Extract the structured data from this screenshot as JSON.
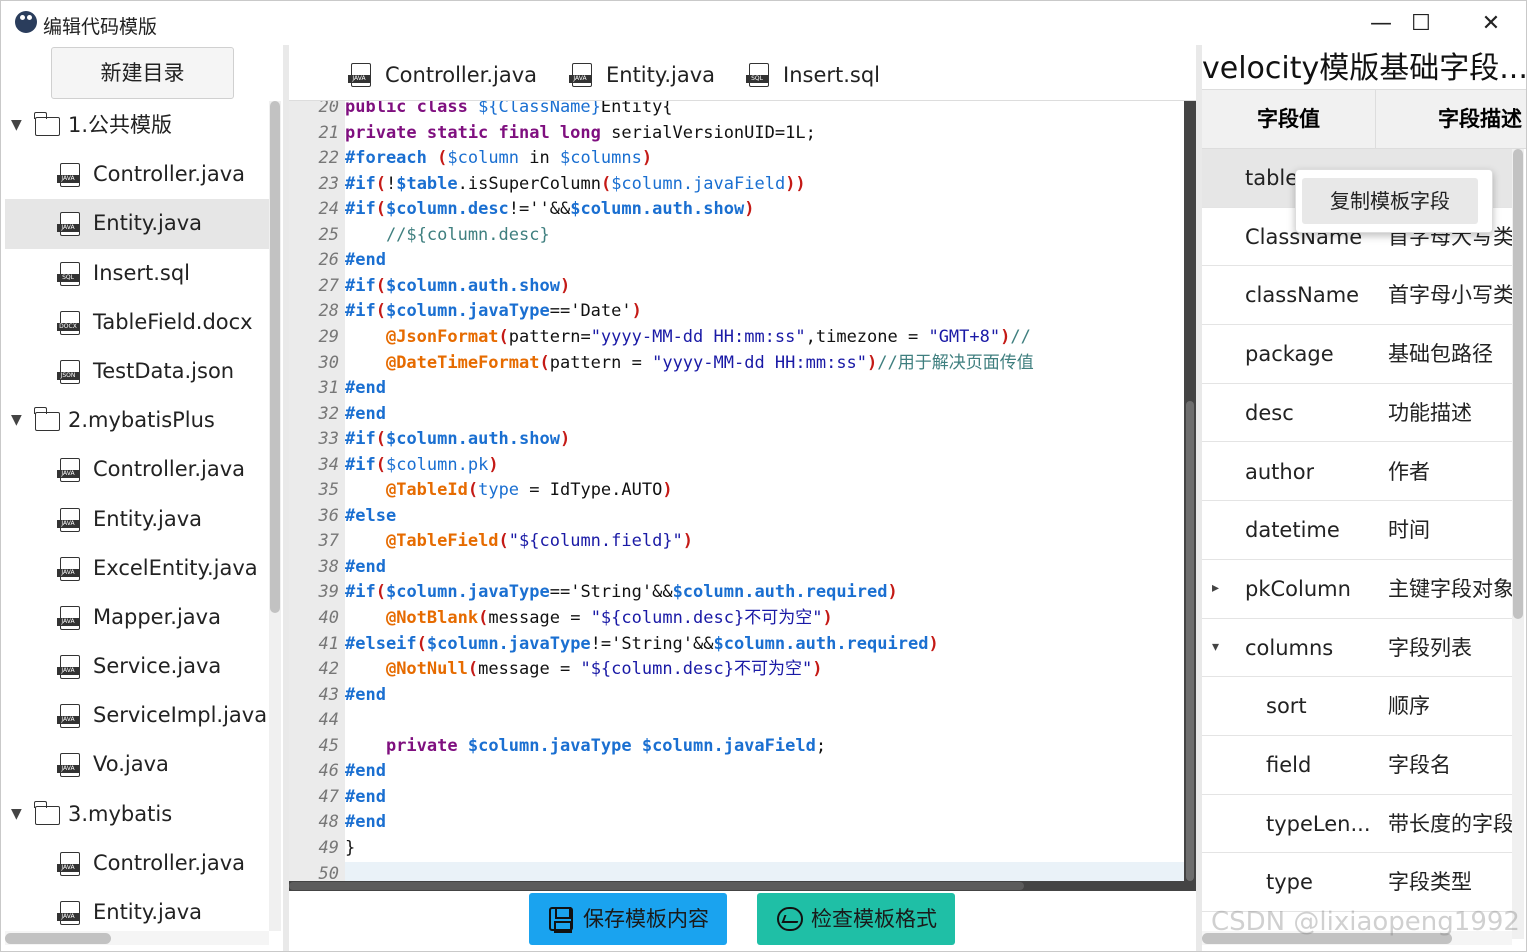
{
  "window": {
    "title": "编辑代码模版",
    "minimize": "—",
    "maximize": "☐",
    "close": "✕"
  },
  "left": {
    "new_dir_label": "新建目录",
    "tree": [
      {
        "kind": "folder",
        "label": "1.公共模版",
        "expanded": true
      },
      {
        "kind": "file",
        "label": "Controller.java",
        "ext": "JAVA"
      },
      {
        "kind": "file",
        "label": "Entity.java",
        "ext": "JAVA",
        "selected": true
      },
      {
        "kind": "file",
        "label": "Insert.sql",
        "ext": "SQL"
      },
      {
        "kind": "file",
        "label": "TableField.docx",
        "ext": "DOCX"
      },
      {
        "kind": "file",
        "label": "TestData.json",
        "ext": "JSON"
      },
      {
        "kind": "folder",
        "label": "2.mybatisPlus",
        "expanded": true
      },
      {
        "kind": "file",
        "label": "Controller.java",
        "ext": "JAVA"
      },
      {
        "kind": "file",
        "label": "Entity.java",
        "ext": "JAVA"
      },
      {
        "kind": "file",
        "label": "ExcelEntity.java",
        "ext": "JAVA"
      },
      {
        "kind": "file",
        "label": "Mapper.java",
        "ext": "JAVA"
      },
      {
        "kind": "file",
        "label": "Service.java",
        "ext": "JAVA"
      },
      {
        "kind": "file",
        "label": "ServiceImpl.java",
        "ext": "JAVA"
      },
      {
        "kind": "file",
        "label": "Vo.java",
        "ext": "JAVA"
      },
      {
        "kind": "folder",
        "label": "3.mybatis",
        "expanded": true
      },
      {
        "kind": "file",
        "label": "Controller.java",
        "ext": "JAVA"
      },
      {
        "kind": "file",
        "label": "Entity.java",
        "ext": "JAVA"
      }
    ]
  },
  "editor": {
    "tabs": [
      {
        "label": "Controller.java",
        "ext": "JAVA"
      },
      {
        "label": "Entity.java",
        "ext": "JAVA"
      },
      {
        "label": "Insert.sql",
        "ext": "SQL"
      }
    ],
    "colors": {
      "keyword": "#7f0f7f",
      "directive": "#1a6fd1",
      "variable": "#1a6fd1",
      "annotation": "#e66b00",
      "string": "#1a1aa6",
      "paren": "#c41a16",
      "comment": "#3f7f7f"
    },
    "lines": [
      {
        "n": "20",
        "tokens": [
          [
            "kw",
            "public class "
          ],
          [
            "var",
            "${ClassName}"
          ],
          [
            "",
            "Entity{"
          ]
        ]
      },
      {
        "n": "21",
        "tokens": [
          [
            "kw",
            "private static final long "
          ],
          [
            "",
            "serialVersionUID=1L;"
          ]
        ]
      },
      {
        "n": "22",
        "tokens": [
          [
            "dir",
            "#foreach "
          ],
          [
            "par",
            "("
          ],
          [
            "var",
            "$column"
          ],
          [
            "",
            " in "
          ],
          [
            "var",
            "$columns"
          ],
          [
            "par",
            ")"
          ]
        ]
      },
      {
        "n": "23",
        "tokens": [
          [
            "dir",
            "#if"
          ],
          [
            "par",
            "("
          ],
          [
            "",
            "!"
          ],
          [
            "var",
            "$table"
          ],
          [
            "",
            ".isSuperColumn"
          ],
          [
            "par",
            "("
          ],
          [
            "var",
            "$column.javaField"
          ],
          [
            "par",
            "))"
          ]
        ]
      },
      {
        "n": "24",
        "tokens": [
          [
            "dir",
            "#if"
          ],
          [
            "par",
            "("
          ],
          [
            "var",
            "$column.desc"
          ],
          [
            "",
            "!=''&&"
          ],
          [
            "var",
            "$column.auth.show"
          ],
          [
            "par",
            ")"
          ]
        ]
      },
      {
        "n": "25",
        "tokens": [
          [
            "com",
            "    //${column.desc}"
          ]
        ]
      },
      {
        "n": "26",
        "tokens": [
          [
            "dir",
            "#end"
          ]
        ]
      },
      {
        "n": "27",
        "tokens": [
          [
            "dir",
            "#if"
          ],
          [
            "par",
            "("
          ],
          [
            "var",
            "$column.auth.show"
          ],
          [
            "par",
            ")"
          ]
        ]
      },
      {
        "n": "28",
        "tokens": [
          [
            "dir",
            "#if"
          ],
          [
            "par",
            "("
          ],
          [
            "var",
            "$column.javaType"
          ],
          [
            "",
            "=='Date'"
          ],
          [
            "par",
            ")"
          ]
        ]
      },
      {
        "n": "29",
        "tokens": [
          [
            "",
            "    "
          ],
          [
            "ann",
            "@JsonFormat"
          ],
          [
            "par",
            "("
          ],
          [
            "",
            "pattern="
          ],
          [
            "str",
            "\"yyyy-MM-dd HH:mm:ss\""
          ],
          [
            "",
            ",timezone = "
          ],
          [
            "str",
            "\"GMT+8\""
          ],
          [
            "par",
            ")"
          ],
          [
            "com",
            "//"
          ]
        ]
      },
      {
        "n": "30",
        "tokens": [
          [
            "",
            "    "
          ],
          [
            "ann",
            "@DateTimeFormat"
          ],
          [
            "par",
            "("
          ],
          [
            "",
            "pattern = "
          ],
          [
            "str",
            "\"yyyy-MM-dd HH:mm:ss\""
          ],
          [
            "par",
            ")"
          ],
          [
            "com",
            "//用于解决页面传值"
          ]
        ]
      },
      {
        "n": "31",
        "tokens": [
          [
            "dir",
            "#end"
          ]
        ]
      },
      {
        "n": "32",
        "tokens": [
          [
            "dir",
            "#end"
          ]
        ]
      },
      {
        "n": "33",
        "tokens": [
          [
            "dir",
            "#if"
          ],
          [
            "par",
            "("
          ],
          [
            "var",
            "$column.auth.show"
          ],
          [
            "par",
            ")"
          ]
        ]
      },
      {
        "n": "34",
        "tokens": [
          [
            "dir",
            "#if"
          ],
          [
            "par",
            "("
          ],
          [
            "var",
            "$column.pk"
          ],
          [
            "par",
            ")"
          ]
        ]
      },
      {
        "n": "35",
        "tokens": [
          [
            "",
            "    "
          ],
          [
            "ann",
            "@TableId"
          ],
          [
            "par",
            "("
          ],
          [
            "var",
            "type"
          ],
          [
            "",
            " = IdType.AUTO"
          ],
          [
            "par",
            ")"
          ]
        ]
      },
      {
        "n": "36",
        "tokens": [
          [
            "dir",
            "#else"
          ]
        ]
      },
      {
        "n": "37",
        "tokens": [
          [
            "",
            "    "
          ],
          [
            "ann",
            "@TableField"
          ],
          [
            "par",
            "("
          ],
          [
            "str",
            "\"${column.field}\""
          ],
          [
            "par",
            ")"
          ]
        ]
      },
      {
        "n": "38",
        "tokens": [
          [
            "dir",
            "#end"
          ]
        ]
      },
      {
        "n": "39",
        "tokens": [
          [
            "dir",
            "#if"
          ],
          [
            "par",
            "("
          ],
          [
            "var",
            "$column.javaType"
          ],
          [
            "",
            "=='String'&&"
          ],
          [
            "var",
            "$column.auth.required"
          ],
          [
            "par",
            ")"
          ]
        ]
      },
      {
        "n": "40",
        "tokens": [
          [
            "",
            "    "
          ],
          [
            "ann",
            "@NotBlank"
          ],
          [
            "par",
            "("
          ],
          [
            "",
            "message = "
          ],
          [
            "str",
            "\"${column.desc}不可为空\""
          ],
          [
            "par",
            ")"
          ]
        ]
      },
      {
        "n": "41",
        "tokens": [
          [
            "dir",
            "#elseif"
          ],
          [
            "par",
            "("
          ],
          [
            "var",
            "$column.javaType"
          ],
          [
            "",
            "!='String'&&"
          ],
          [
            "var",
            "$column.auth.required"
          ],
          [
            "par",
            ")"
          ]
        ]
      },
      {
        "n": "42",
        "tokens": [
          [
            "",
            "    "
          ],
          [
            "ann",
            "@NotNull"
          ],
          [
            "par",
            "("
          ],
          [
            "",
            "message = "
          ],
          [
            "str",
            "\"${column.desc}不可为空\""
          ],
          [
            "par",
            ")"
          ]
        ]
      },
      {
        "n": "43",
        "tokens": [
          [
            "dir",
            "#end"
          ]
        ]
      },
      {
        "n": "44",
        "tokens": []
      },
      {
        "n": "45",
        "tokens": [
          [
            "",
            "    "
          ],
          [
            "kw",
            "private "
          ],
          [
            "var",
            "$column.javaType $column.javaField"
          ],
          [
            "",
            ";"
          ]
        ]
      },
      {
        "n": "46",
        "tokens": [
          [
            "dir",
            "#end"
          ]
        ]
      },
      {
        "n": "47",
        "tokens": [
          [
            "dir",
            "#end"
          ]
        ]
      },
      {
        "n": "48",
        "tokens": [
          [
            "dir",
            "#end"
          ]
        ]
      },
      {
        "n": "49",
        "tokens": [
          [
            "",
            "}"
          ]
        ]
      },
      {
        "n": "50",
        "tokens": [],
        "current": true
      }
    ]
  },
  "buttons": {
    "save": "保存模板内容",
    "check": "检查模板格式"
  },
  "right": {
    "title": "velocity模版基础字段...",
    "header": {
      "col1": "字段值",
      "col2": "字段描述"
    },
    "rows": [
      {
        "key": "table",
        "val": "",
        "selected": true
      },
      {
        "key": "ClassName",
        "val": "首字母大写类"
      },
      {
        "key": "className",
        "val": "首字母小写类"
      },
      {
        "key": "package",
        "val": "基础包路径"
      },
      {
        "key": "desc",
        "val": "功能描述"
      },
      {
        "key": "author",
        "val": "作者"
      },
      {
        "key": "datetime",
        "val": "时间"
      },
      {
        "key": "pkColumn",
        "val": "主键字段对象",
        "caret": "▸"
      },
      {
        "key": "columns",
        "val": "字段列表",
        "caret": "▾"
      },
      {
        "key": "sort",
        "val": "顺序",
        "sub": true
      },
      {
        "key": "field",
        "val": "字段名",
        "sub": true
      },
      {
        "key": "typeLen...",
        "val": "带长度的字段",
        "sub": true
      },
      {
        "key": "type",
        "val": "字段类型",
        "sub": true
      }
    ],
    "context_menu": {
      "item": "复制模板字段"
    }
  },
  "watermark": "CSDN @lixiaopeng1992"
}
